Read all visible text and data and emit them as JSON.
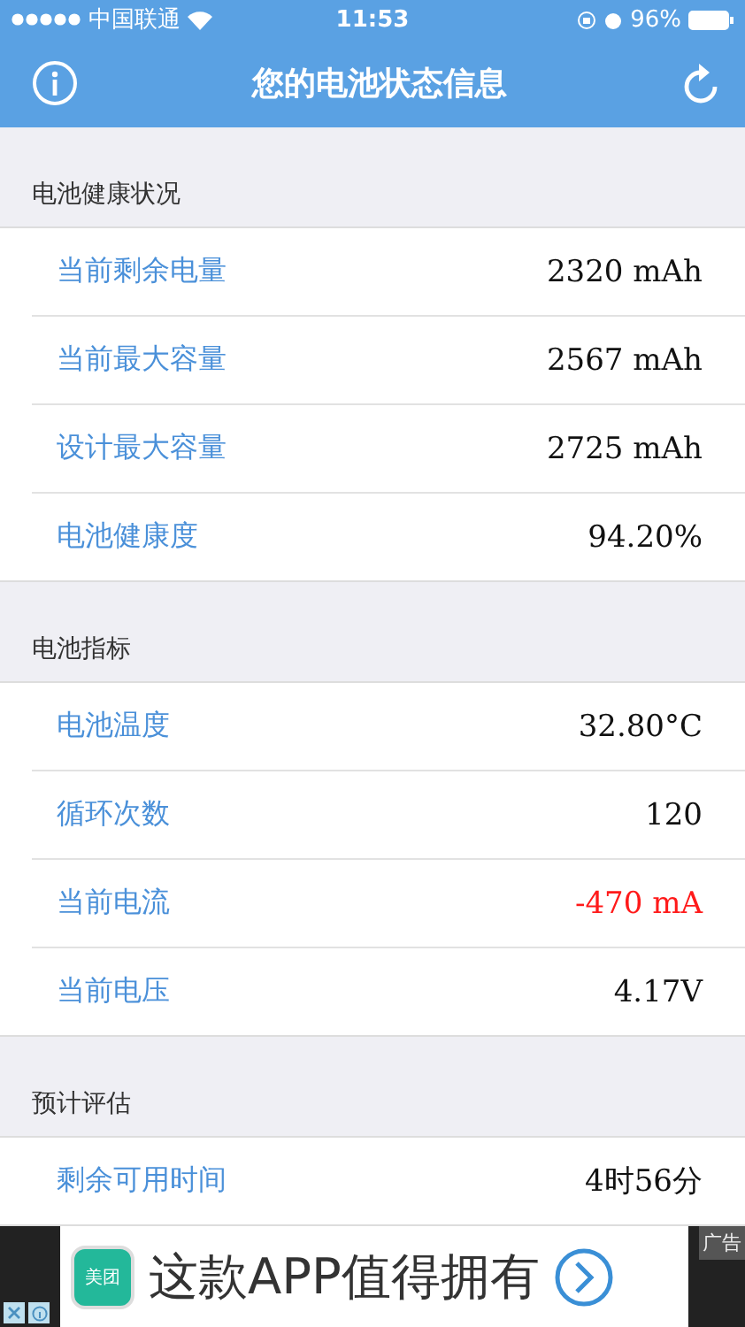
{
  "status_bar": {
    "carrier": "中国联通",
    "time": "11:53",
    "battery": "96%"
  },
  "nav": {
    "title": "您的电池状态信息"
  },
  "sections": [
    {
      "header": "电池健康状况",
      "rows": [
        {
          "label": "当前剩余电量",
          "value": "2320 mAh",
          "alert": false
        },
        {
          "label": "当前最大容量",
          "value": "2567 mAh",
          "alert": false
        },
        {
          "label": "设计最大容量",
          "value": "2725 mAh",
          "alert": false
        },
        {
          "label": "电池健康度",
          "value": "94.20%",
          "alert": false
        }
      ]
    },
    {
      "header": "电池指标",
      "rows": [
        {
          "label": "电池温度",
          "value": "32.80°C",
          "alert": false
        },
        {
          "label": "循环次数",
          "value": "120",
          "alert": false
        },
        {
          "label": "当前电流",
          "value": "-470 mA",
          "alert": true
        },
        {
          "label": "当前电压",
          "value": "4.17V",
          "alert": false
        }
      ]
    },
    {
      "header": "预计评估",
      "rows": [
        {
          "label": "剩余可用时间",
          "value": "4时56分",
          "alert": false
        }
      ]
    }
  ],
  "ad": {
    "logo": "美团",
    "text": "这款APP值得拥有",
    "tag": "广告"
  }
}
